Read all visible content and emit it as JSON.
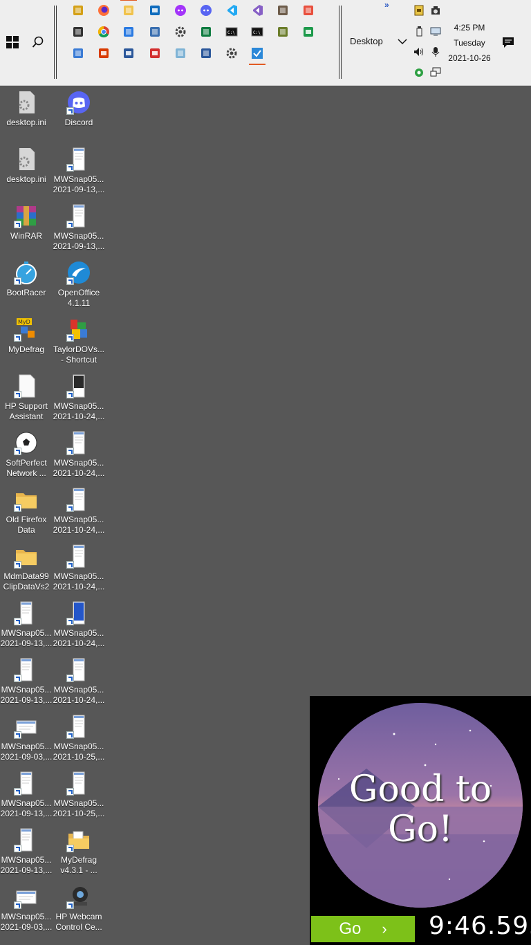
{
  "taskbar": {
    "start_icon": "windows-logo-icon",
    "search_icon": "search-icon",
    "quick_launch": [
      {
        "name": "winrar-icon",
        "color": "#d4a017"
      },
      {
        "name": "firefox-icon",
        "color": "#ff7139"
      },
      {
        "name": "file-explorer-icon",
        "color": "#f0c24b"
      },
      {
        "name": "outlook-icon",
        "color": "#0f6cbd"
      },
      {
        "name": "messenger-icon",
        "color": "#a334fa"
      },
      {
        "name": "discord-icon",
        "color": "#5865f2"
      },
      {
        "name": "vscode-icon",
        "color": "#23a9f2"
      },
      {
        "name": "visual-studio-icon",
        "color": "#865fc5"
      },
      {
        "name": "gimp-icon",
        "color": "#6d5c4a"
      },
      {
        "name": "paint-icon",
        "color": "#e84f3d"
      },
      {
        "name": "webcam-icon",
        "color": "#333333"
      },
      {
        "name": "chrome-icon",
        "color": "#4285f4"
      },
      {
        "name": "network-app-icon",
        "color": "#2a7ae2"
      },
      {
        "name": "control-panel-icon",
        "color": "#3a6fb0"
      },
      {
        "name": "settings-gear-icon",
        "color": "#444444"
      },
      {
        "name": "green-app-icon",
        "color": "#107c41"
      },
      {
        "name": "command-prompt-icon",
        "color": "#111111"
      },
      {
        "name": "command-prompt-admin-icon",
        "color": "#111111"
      },
      {
        "name": "tree-app-icon",
        "color": "#6b7d2a"
      },
      {
        "name": "excel-icon",
        "color": "#1d9a4b"
      },
      {
        "name": "system-info-icon",
        "color": "#3a7bd5"
      },
      {
        "name": "office-icon",
        "color": "#d83b01"
      },
      {
        "name": "word-icon",
        "color": "#2b579a"
      },
      {
        "name": "acrobat-icon",
        "color": "#d32f2f"
      },
      {
        "name": "notepad-icon",
        "color": "#7fb3d5"
      },
      {
        "name": "document-icon",
        "color": "#2b579a"
      },
      {
        "name": "clock-app-icon",
        "color": "#444444"
      },
      {
        "name": "todo-check-icon",
        "color": "#2b88d8"
      }
    ],
    "toolbar_label": "Desktop",
    "more_label": "»",
    "clock": {
      "time": "4:25 PM",
      "day": "Tuesday",
      "date": "2021-10-26"
    }
  },
  "desktop": {
    "columns": [
      [
        {
          "label": "desktop.ini",
          "icon": "settings-file-icon"
        },
        {
          "label": "desktop.ini",
          "icon": "settings-file-icon"
        },
        {
          "label": "WinRAR",
          "icon": "winrar-icon"
        },
        {
          "label": "BootRacer",
          "icon": "stopwatch-icon"
        },
        {
          "label": "MyDefrag",
          "icon": "mydefrag-icon"
        },
        {
          "label": "HP Support\nAssistant",
          "icon": "blank-file-icon"
        },
        {
          "label": "SoftPerfect\nNetwork ...",
          "icon": "soccer-ball-icon"
        },
        {
          "label": "Old Firefox\nData",
          "icon": "folder-icon"
        },
        {
          "label": "MdmData99\nClipDataVs2",
          "icon": "folder-icon"
        },
        {
          "label": "MWSnap05...\n2021-09-13,...",
          "icon": "screenshot-file-icon"
        },
        {
          "label": "MWSnap05...\n2021-09-13,...",
          "icon": "screenshot-file-icon"
        },
        {
          "label": "MWSnap05...\n2021-09-03,...",
          "icon": "screenshot-wide-icon"
        },
        {
          "label": "MWSnap05...\n2021-09-13,...",
          "icon": "screenshot-file-icon"
        },
        {
          "label": "MWSnap05...\n2021-09-13,...",
          "icon": "screenshot-file-icon"
        },
        {
          "label": "MWSnap05...\n2021-09-03,...",
          "icon": "screenshot-wide-icon"
        }
      ],
      [
        {
          "label": "Discord",
          "icon": "discord-icon"
        },
        {
          "label": "MWSnap05...\n2021-09-13,...",
          "icon": "screenshot-file-icon"
        },
        {
          "label": "MWSnap05...\n2021-09-13,...",
          "icon": "screenshot-file-icon"
        },
        {
          "label": "OpenOffice\n4.1.11",
          "icon": "openoffice-icon"
        },
        {
          "label": "TaylorDOVs...\n- Shortcut",
          "icon": "colorful-blocks-icon"
        },
        {
          "label": "MWSnap05...\n2021-10-24,...",
          "icon": "screenshot-dark-icon"
        },
        {
          "label": "MWSnap05...\n2021-10-24,...",
          "icon": "screenshot-file-icon"
        },
        {
          "label": "MWSnap05...\n2021-10-24,...",
          "icon": "screenshot-file-icon"
        },
        {
          "label": "MWSnap05...\n2021-10-24,...",
          "icon": "screenshot-file-icon"
        },
        {
          "label": "MWSnap05...\n2021-10-24,...",
          "icon": "screenshot-blue-icon"
        },
        {
          "label": "MWSnap05...\n2021-10-24,...",
          "icon": "screenshot-file-icon"
        },
        {
          "label": "MWSnap05...\n2021-10-25,...",
          "icon": "screenshot-file-icon"
        },
        {
          "label": "MWSnap05...\n2021-10-25,...",
          "icon": "screenshot-file-icon"
        },
        {
          "label": "MyDefrag\nv4.3.1 - ...",
          "icon": "folder-docs-icon"
        },
        {
          "label": "HP Webcam\nControl Ce...",
          "icon": "webcam-icon"
        }
      ]
    ]
  },
  "widget": {
    "message": "Good to Go!",
    "button_label": "Go",
    "button_chevron": "›",
    "timer": "9:46.593",
    "accent": "#7dc119"
  }
}
